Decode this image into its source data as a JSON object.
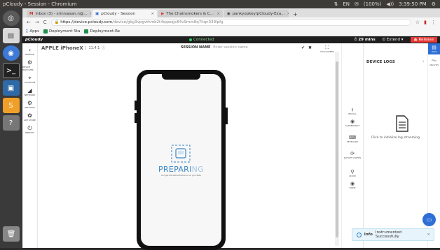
{
  "os": {
    "window_title": "pCloudy - Session - Chromium",
    "tray": [
      "⇅",
      "EN",
      "✉",
      "(100%)",
      "◀))",
      "3:39:50 PM",
      "⚙"
    ]
  },
  "launcher": {
    "icons": [
      "ubuntu-logo-icon",
      "files-icon",
      "chromium-icon",
      "terminal-icon",
      "virtualbox-icon",
      "sublime-icon",
      "help-icon",
      "trash-icon"
    ]
  },
  "browser": {
    "tabs": [
      {
        "icon": "M",
        "label": "Inbox (3) - srinivasan.n@..."
      },
      {
        "icon": "▣",
        "label": "pCloudy - Session"
      },
      {
        "icon": "▶",
        "label": "The Chainsmokers & C..."
      },
      {
        "icon": "◉",
        "label": "pankyopkey/pCloudy-Exa..."
      }
    ],
    "new_tab": "+",
    "url_host": "https://device.pcloudy.com",
    "url_path": "/device/gkg3vpgvthmb2t4qqwqjc84v9mm8q7hqn339lpfg",
    "bookmarks": [
      "Apps",
      "Deployment Sta",
      "Deployment-Re"
    ]
  },
  "appbar": {
    "logo": "pCloudy",
    "status": "Connected",
    "timer": "29 mins",
    "extend": "Extend ▾",
    "release": "Release"
  },
  "leftbar": [
    {
      "glyph": "‹",
      "label": "REMOVE"
    },
    {
      "glyph": "⚙",
      "label": "DEVICE DISCOVER"
    },
    {
      "glyph": "⌖",
      "label": "LOCATION"
    },
    {
      "glyph": "◢",
      "label": "NETWORK"
    },
    {
      "glyph": "⚙",
      "label": "SETTINGS"
    },
    {
      "glyph": "✿",
      "label": "APP STORE"
    },
    {
      "glyph": "⏻",
      "label": "REBOOT"
    }
  ],
  "device": {
    "name": "APPLE iPhoneX",
    "os_version": "11.4.1",
    "session_label": "SESSION NAME",
    "session_placeholder": "Enter session name",
    "confirm": "✔",
    "cancel": "✖",
    "fullscreen_label": "FULLSCREEN",
    "preparing_main": "PREPARI",
    "preparing_tail": "NG",
    "preparing_sub": "Do type the authentication & run your tests"
  },
  "tools": [
    {
      "glyph": "⭳",
      "label": "INSTALL"
    },
    {
      "glyph": "◉",
      "label": "SCREENSHOT"
    },
    {
      "glyph": "⌨",
      "label": "KEYBOARD"
    },
    {
      "glyph": "⟳",
      "label": "ROTATE SCREEN"
    },
    {
      "glyph": "⚲",
      "label": "ZOOM"
    },
    {
      "glyph": "◉",
      "label": "HOME"
    }
  ],
  "logs": {
    "title": "DEVICE LOGS",
    "empty": "Click to initialize log streaming."
  },
  "rightrail": [
    {
      "glyph": "▤",
      "label": "LOGS"
    },
    {
      "glyph": "〜",
      "label": "ANALYSIS"
    }
  ],
  "toast": {
    "title": "Info",
    "message": "Instrumented Successfully",
    "close": "×"
  },
  "colors": {
    "accent": "#2d6fd6",
    "release": "#e53935",
    "preparing": "#3b86c6",
    "connected": "#2ecc71"
  }
}
